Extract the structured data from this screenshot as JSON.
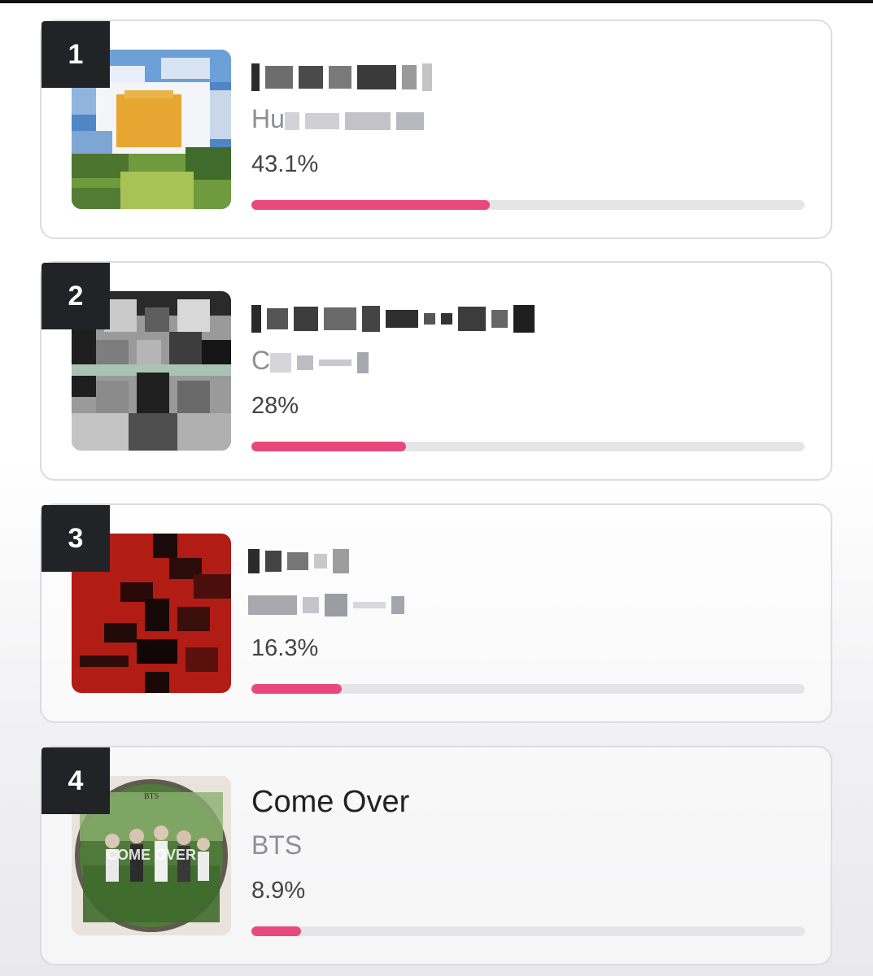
{
  "entries": [
    {
      "rank": "1",
      "title": "",
      "artist": "Hu",
      "percent_label": "43.1%",
      "percent": 43.1,
      "cover_icon": "album-cover-daisy-sky"
    },
    {
      "rank": "2",
      "title": "",
      "artist": "C",
      "percent_label": "28%",
      "percent": 28,
      "cover_icon": "album-cover-grayscale-portrait"
    },
    {
      "rank": "3",
      "title": "",
      "artist": "",
      "percent_label": "16.3%",
      "percent": 16.3,
      "cover_icon": "album-cover-red-abstract"
    },
    {
      "rank": "4",
      "title": "Come Over",
      "artist": "BTS",
      "percent_label": "8.9%",
      "percent": 8.9,
      "cover_icon": "album-cover-come-over"
    }
  ],
  "colors": {
    "bar_fill": "#e8497c",
    "bar_track": "#e4e4e9",
    "rank_badge": "#222326"
  }
}
